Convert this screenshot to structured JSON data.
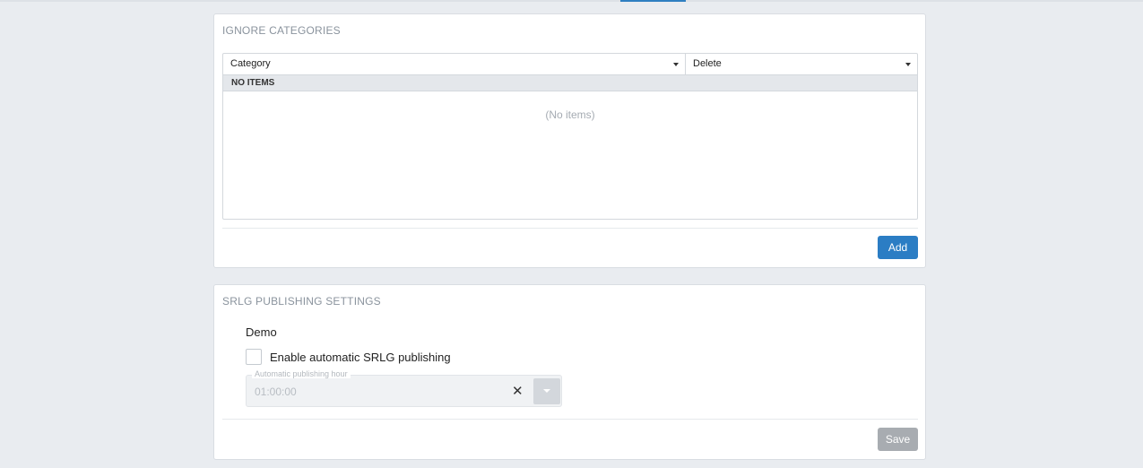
{
  "ignore_categories": {
    "title": "IGNORE CATEGORIES",
    "columns": [
      "Category",
      "Delete"
    ],
    "group_label": "NO ITEMS",
    "empty_text": "(No items)",
    "add_label": "Add"
  },
  "srlg_publishing": {
    "title": "SRLG PUBLISHING SETTINGS",
    "section_label": "Demo",
    "checkbox_label": "Enable automatic SRLG publishing",
    "checkbox_checked": false,
    "hour_field": {
      "label": "Automatic publishing hour",
      "value": "01:00:00"
    },
    "clear_glyph": "✕",
    "save_label": "Save"
  },
  "icons": {
    "sort_caret": "caret-down-icon",
    "clear": "close-icon",
    "dropdown": "chevron-down-icon"
  },
  "colors": {
    "accent": "#2b7dc4",
    "disabled_button": "#a8acb1",
    "page_background": "#e9ecf0"
  }
}
